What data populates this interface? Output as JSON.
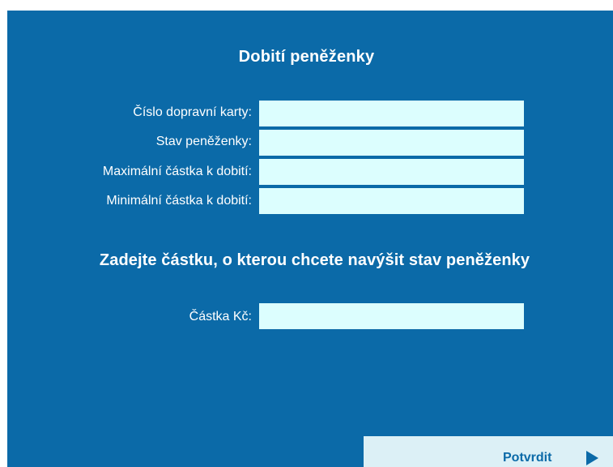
{
  "page": {
    "title": "Dobití peněženky",
    "subtitle": "Zadejte částku, o kterou chcete navýšit stav peněženky"
  },
  "form": {
    "card_number": {
      "label": "Číslo dopravní karty:",
      "value": ""
    },
    "wallet_balance": {
      "label": "Stav peněženky:",
      "value": ""
    },
    "max_topup": {
      "label": "Maximální částka k dobití:",
      "value": ""
    },
    "min_topup": {
      "label": "Minimální částka k dobití:",
      "value": ""
    },
    "amount": {
      "label": "Částka Kč:",
      "value": ""
    }
  },
  "actions": {
    "confirm_label": "Potvrdit",
    "confirm_icon": "play-icon"
  },
  "colors": {
    "panel_bg": "#0b6aa8",
    "input_bg": "#dcfefe",
    "button_bg": "#dcf0f6",
    "text_white": "#ffffff",
    "accent": "#0b6aa8"
  }
}
